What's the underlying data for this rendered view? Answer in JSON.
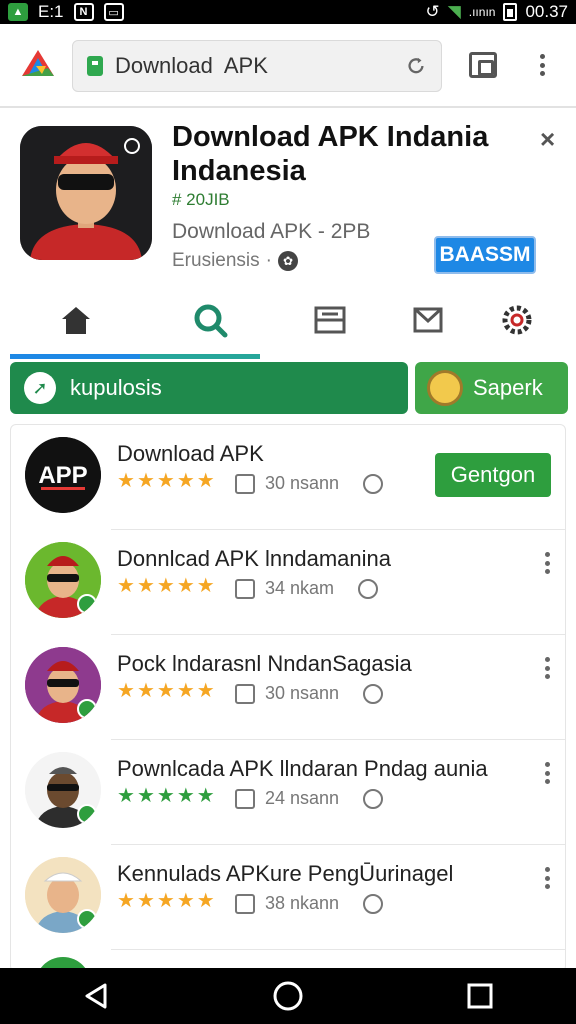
{
  "status_bar": {
    "left_label": "E:1",
    "network_label": ".ıının",
    "time": "00.37"
  },
  "browser": {
    "url_text": "Download  APK",
    "icons": [
      "browser-logo-icon",
      "lock-icon",
      "reload-icon",
      "tab-switcher-icon",
      "more-vert-icon"
    ]
  },
  "app": {
    "title": "Download APK Indania Indanesia",
    "size": "# 20ЈIB",
    "subtitle": "Download APK - 2PB",
    "developer": "Erusiensis",
    "install_label": "BAASSM",
    "close_label": "×"
  },
  "tabs": [
    {
      "name": "home",
      "icon": "home-icon",
      "color": "#333333"
    },
    {
      "name": "search",
      "icon": "search-icon",
      "color": "#1f8a6b"
    },
    {
      "name": "categories",
      "icon": "tray-icon",
      "color": "#555555"
    },
    {
      "name": "mail",
      "icon": "mail-icon",
      "color": "#555555"
    },
    {
      "name": "settings",
      "icon": "gear-icon",
      "color": "#333333"
    }
  ],
  "categories": {
    "left_label": "kupulosis",
    "right_label": "Saperk"
  },
  "list": [
    {
      "title": "Download APK",
      "stars": 5,
      "star_color": "#f5a623",
      "meta": "30 nsann",
      "action": "Gentgon",
      "avatar": "app-logo"
    },
    {
      "title": "Donnlcad APK lnndamanina",
      "stars": 5,
      "star_color": "#f5a623",
      "meta": "34 nkam",
      "avatar": "green-avatar"
    },
    {
      "title": "Pock lndarasnl NndanSagasia",
      "stars": 5,
      "star_color": "#f5a623",
      "meta": "30 nsann",
      "avatar": "purple-avatar"
    },
    {
      "title": "Pownlcada APK llndaran Pndag aunia",
      "stars": 5,
      "star_color": "#2e9e3e",
      "meta": "24 nsann",
      "avatar": "white-avatar"
    },
    {
      "title": "Kennulads APKure PengŪurinagel",
      "stars": 5,
      "star_color": "#f5a623",
      "meta": "38 nkann",
      "avatar": "cream-avatar"
    }
  ],
  "nav": [
    "back-icon",
    "home-circle-icon",
    "recents-icon"
  ]
}
